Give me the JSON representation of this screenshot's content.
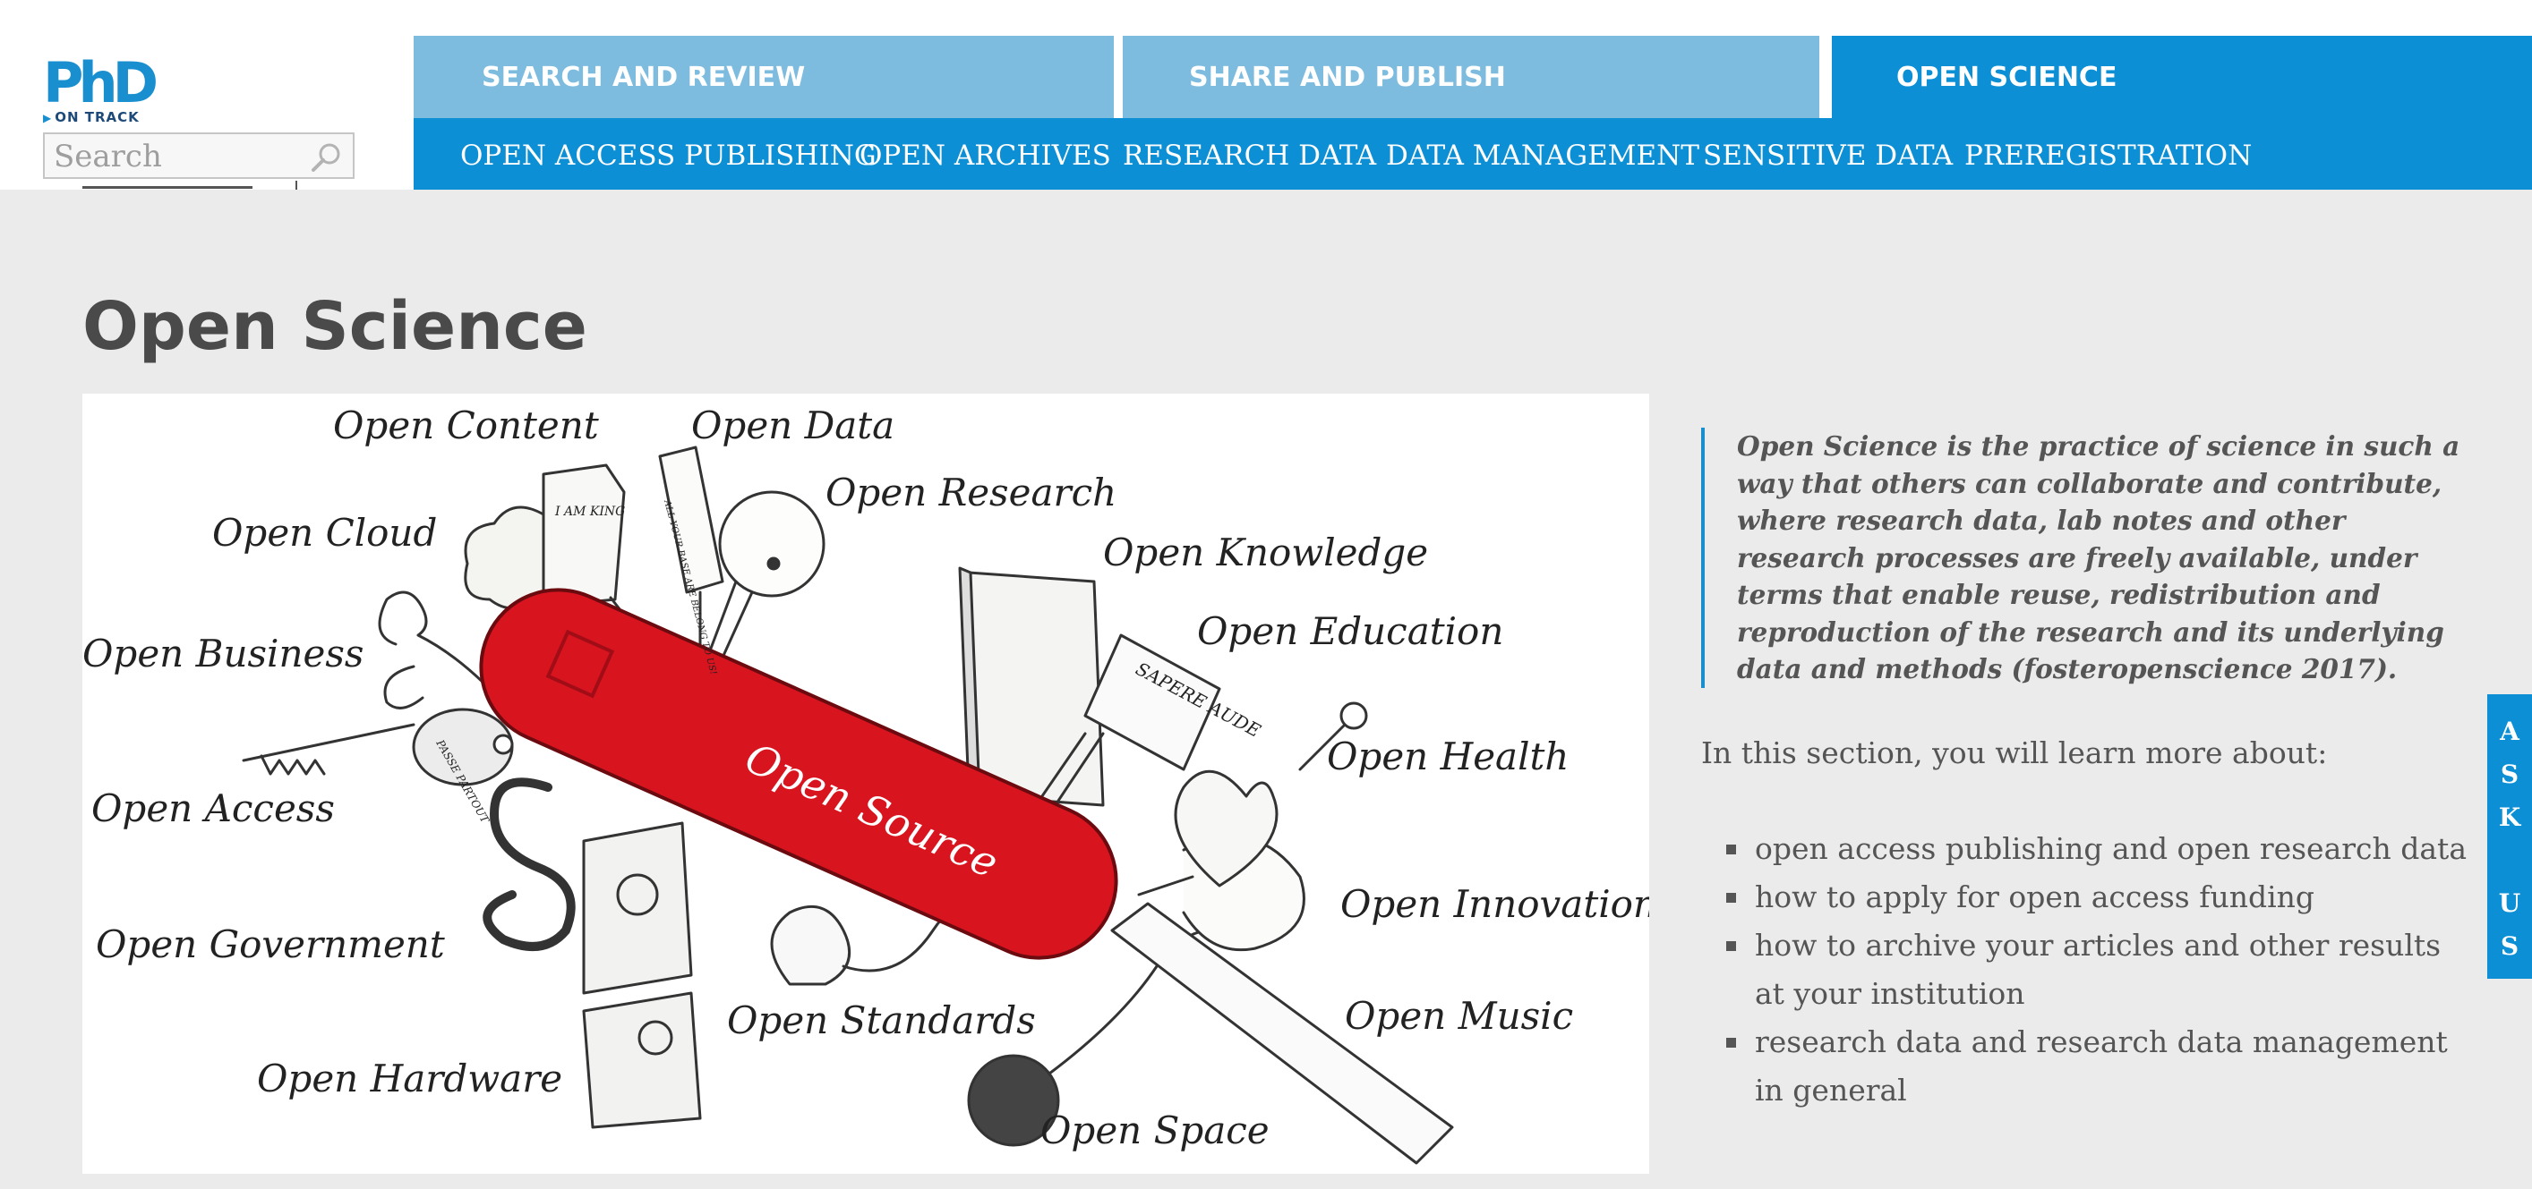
{
  "header": {
    "logo": {
      "main": "PhD",
      "sub": "ON TRACK"
    },
    "search": {
      "placeholder": "Search"
    },
    "tabs": [
      {
        "label": "SEARCH AND REVIEW",
        "active": false
      },
      {
        "label": "SHARE AND PUBLISH",
        "active": false
      },
      {
        "label": "OPEN SCIENCE",
        "active": true
      }
    ],
    "subnav": [
      "OPEN ACCESS PUBLISHING",
      "OPEN ARCHIVES",
      "RESEARCH DATA",
      "DATA MANAGEMENT",
      "SENSITIVE DATA",
      "PREREGISTRATION"
    ]
  },
  "main": {
    "title": "Open Science",
    "illustration": {
      "blade_label": "Open Source",
      "labels": [
        "Open Content",
        "Open Data",
        "Open Research",
        "Open Cloud",
        "Open Knowledge",
        "Open Education",
        "Open Business",
        "Open Health",
        "Open Access",
        "Open Innovation",
        "Open Government",
        "Open Standards",
        "Open Music",
        "Open Hardware",
        "Open Space"
      ],
      "small_texts": [
        "I AM KING",
        "ALL YOUR BASE ARE BELONG TO US!",
        "SAPERE AUDE",
        "PASSE PARTOUT"
      ]
    },
    "quote": "Open Science is the practice of science in such a way that others can collaborate and contribute, where research data, lab notes and other research processes are freely available, under terms that enable reuse, redistribution and reproduction of the research and its underlying data and methods (fosteropenscience 2017).",
    "intro": "In this section, you will learn more about:",
    "topics": [
      "open access publishing and open research data",
      "how to apply for open access funding",
      "how to archive your articles and other results at your institution",
      "research data and research data management in general"
    ]
  },
  "ask_us": {
    "letters": [
      "A",
      "S",
      "K",
      "",
      "U",
      "S"
    ]
  },
  "colors": {
    "brand_blue": "#0c8fd4",
    "light_tab": "#7dbcdf",
    "page_bg": "#ebebeb",
    "text": "#555555",
    "knife_red": "#d8141f"
  }
}
